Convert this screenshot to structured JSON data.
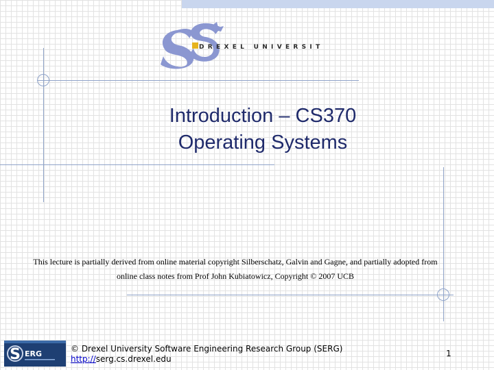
{
  "logo": {
    "university_name": "DREXEL UNIVERSITY"
  },
  "slide": {
    "title_line1": "Introduction – CS370",
    "title_line2": "Operating Systems",
    "credit_line1": "This lecture is partially derived from online material copyright Silberschatz, Galvin and Gagne, and partially adopted from",
    "credit_line2": "online class notes from Prof John Kubiatowicz, Copyright © 2007 UCB"
  },
  "footer": {
    "serg_logo_text": "ERG",
    "copyright": "© Drexel University Software Engineering Research Group (SERG)",
    "link_prefix": "http://",
    "link_rest": "serg.cs.drexel.edu",
    "page_number": "1"
  },
  "colors": {
    "title": "#1f2a6b",
    "rule": "#8fa3c8",
    "topbar": "#c9d6ee",
    "logo_blue": "#8b97d1",
    "logo_gold": "#e6b31e"
  }
}
